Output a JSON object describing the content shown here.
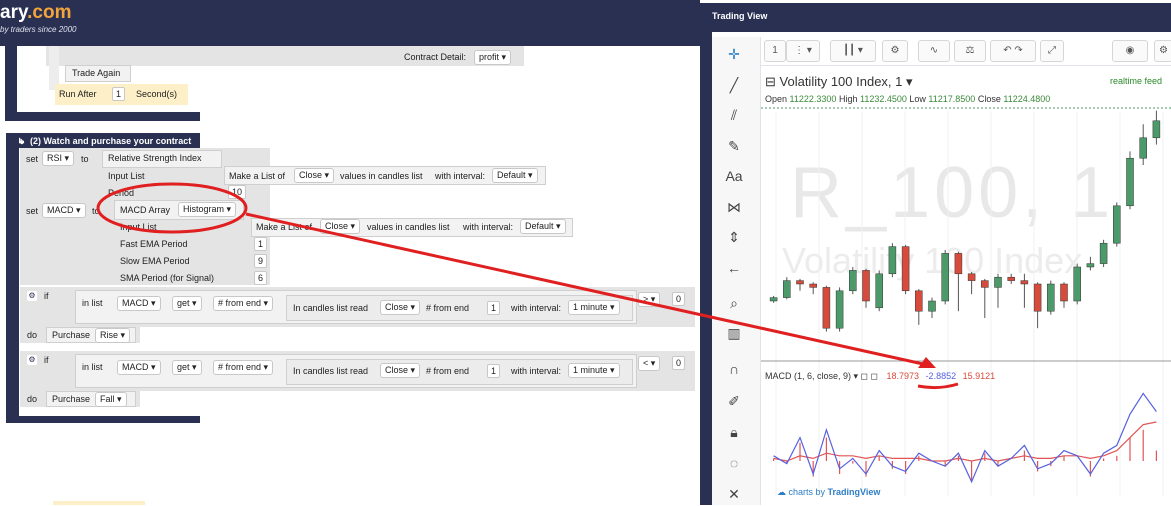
{
  "header": {
    "logo_main": "ary",
    "logo_accent": ".com",
    "tagline": "by traders since 2000"
  },
  "workspace": {
    "contract_detail_label": "Contract Detail:",
    "contract_detail_value": "profit",
    "trade_again": "Trade Again",
    "run_after": "Run After",
    "run_after_value": "1",
    "seconds": "Second(s)",
    "section_title": "(2) Watch and purchase your contract",
    "set": "set",
    "to": "to",
    "rsi_var": "RSI",
    "macd_var": "MACD",
    "rsi_block": "Relative Strength Index",
    "input_list": "Input List",
    "make_list_of": "Make a List of",
    "close": "Close",
    "values_in_candles": "values in candles list",
    "with_interval": "with interval:",
    "default": "Default",
    "period": "Period",
    "period_value": "10",
    "macd_array": "MACD Array",
    "histogram": "Histogram",
    "fast_ema": "Fast EMA Period",
    "fast_ema_value": "1",
    "slow_ema": "Slow EMA Period",
    "slow_ema_value": "9",
    "sma_period": "SMA Period (for Signal)",
    "sma_value": "6",
    "if": "if",
    "in_list": "in list",
    "get": "get",
    "from_end": "# from end",
    "in_candles_read": "In candles list read",
    "interval_1min": "1 minute",
    "cmp_gt": ">",
    "cmp_lt": "<",
    "zero": "0",
    "one": "1",
    "do": "do",
    "purchase": "Purchase",
    "rise": "Rise",
    "fall": "Fall"
  },
  "tradingview": {
    "title": "Trading View",
    "interval": "1",
    "symbol": "Volatility 100 Index, 1",
    "open_label": "Open",
    "open": "11222.3300",
    "high_label": "High",
    "high": "11232.4500",
    "low_label": "Low",
    "low": "11217.8500",
    "close_label": "Close",
    "close": "11224.4800",
    "realtime": "realtime feed",
    "watermark_main": "R_100, 1",
    "watermark_sub": "Volatility 100 Index",
    "macd_label": "MACD (1, 6, close, 9)",
    "macd_v1": "18.7973",
    "macd_v2": "-2.8852",
    "macd_v3": "15.9121",
    "footer": "charts by",
    "footer_brand": "TradingView",
    "colors": {
      "up": "#4c9a6a",
      "down": "#d64b3b",
      "macd": "#5561e0",
      "signal": "#e05555"
    }
  },
  "chart_data": {
    "type": "candlestick",
    "candles": [
      {
        "o": 0,
        "c": 1,
        "h": 1.5,
        "l": -0.5
      },
      {
        "o": 1,
        "c": 6,
        "h": 7,
        "l": 0.5
      },
      {
        "o": 6,
        "c": 5,
        "h": 6.5,
        "l": 3
      },
      {
        "o": 5,
        "c": 4,
        "h": 5.5,
        "l": 2
      },
      {
        "o": 4,
        "c": -8,
        "h": 4.5,
        "l": -9
      },
      {
        "o": -8,
        "c": 3,
        "h": 4,
        "l": -9
      },
      {
        "o": 3,
        "c": 9,
        "h": 10,
        "l": 2
      },
      {
        "o": 9,
        "c": 0,
        "h": 9.5,
        "l": -2
      },
      {
        "o": -2,
        "c": 8,
        "h": 9,
        "l": -3
      },
      {
        "o": 8,
        "c": 16,
        "h": 17,
        "l": 7
      },
      {
        "o": 16,
        "c": 3,
        "h": 16.5,
        "l": 2
      },
      {
        "o": 3,
        "c": -3,
        "h": 3.5,
        "l": -7
      },
      {
        "o": -3,
        "c": 0,
        "h": 1,
        "l": -5
      },
      {
        "o": 0,
        "c": 14,
        "h": 15,
        "l": -1
      },
      {
        "o": 14,
        "c": 8,
        "h": 14.5,
        "l": -3
      },
      {
        "o": 8,
        "c": 6,
        "h": 8.5,
        "l": 2
      },
      {
        "o": 6,
        "c": 4,
        "h": 6.5,
        "l": -5
      },
      {
        "o": 4,
        "c": 7,
        "h": 8,
        "l": -2
      },
      {
        "o": 7,
        "c": 6,
        "h": 8,
        "l": 5
      },
      {
        "o": 6,
        "c": 5,
        "h": 8,
        "l": -2
      },
      {
        "o": 5,
        "c": -3,
        "h": 5.5,
        "l": -8
      },
      {
        "o": -3,
        "c": 5,
        "h": 6,
        "l": -4
      },
      {
        "o": 5,
        "c": 0,
        "h": 5.5,
        "l": -2
      },
      {
        "o": 0,
        "c": 10,
        "h": 11,
        "l": -1
      },
      {
        "o": 10,
        "c": 11,
        "h": 13,
        "l": 9
      },
      {
        "o": 11,
        "c": 17,
        "h": 18,
        "l": 10
      },
      {
        "o": 17,
        "c": 28,
        "h": 29,
        "l": 16
      },
      {
        "o": 28,
        "c": 42,
        "h": 44,
        "l": 27
      },
      {
        "o": 42,
        "c": 48,
        "h": 52,
        "l": 40
      },
      {
        "o": 48,
        "c": 53,
        "h": 56,
        "l": 46
      }
    ],
    "macd_line": [
      2,
      -1,
      9,
      -5,
      12,
      -3,
      1,
      -5,
      4,
      -2,
      -4,
      3,
      0,
      -2,
      3,
      -8,
      4,
      -2,
      1,
      6,
      -3,
      -1,
      4,
      2,
      -5,
      3,
      6,
      18,
      26,
      19
    ],
    "signal_line": [
      1,
      0,
      2,
      1,
      3,
      2,
      2,
      1,
      2,
      1,
      1,
      1,
      0,
      0,
      1,
      0,
      1,
      0,
      1,
      2,
      1,
      1,
      2,
      2,
      1,
      2,
      4,
      9,
      14,
      15
    ],
    "histogram": [
      1,
      -1,
      7,
      -6,
      9,
      -5,
      -1,
      -6,
      2,
      -3,
      -5,
      2,
      0,
      -2,
      2,
      -8,
      3,
      -2,
      0,
      4,
      -4,
      -2,
      2,
      0,
      -6,
      1,
      2,
      9,
      12,
      4
    ]
  }
}
